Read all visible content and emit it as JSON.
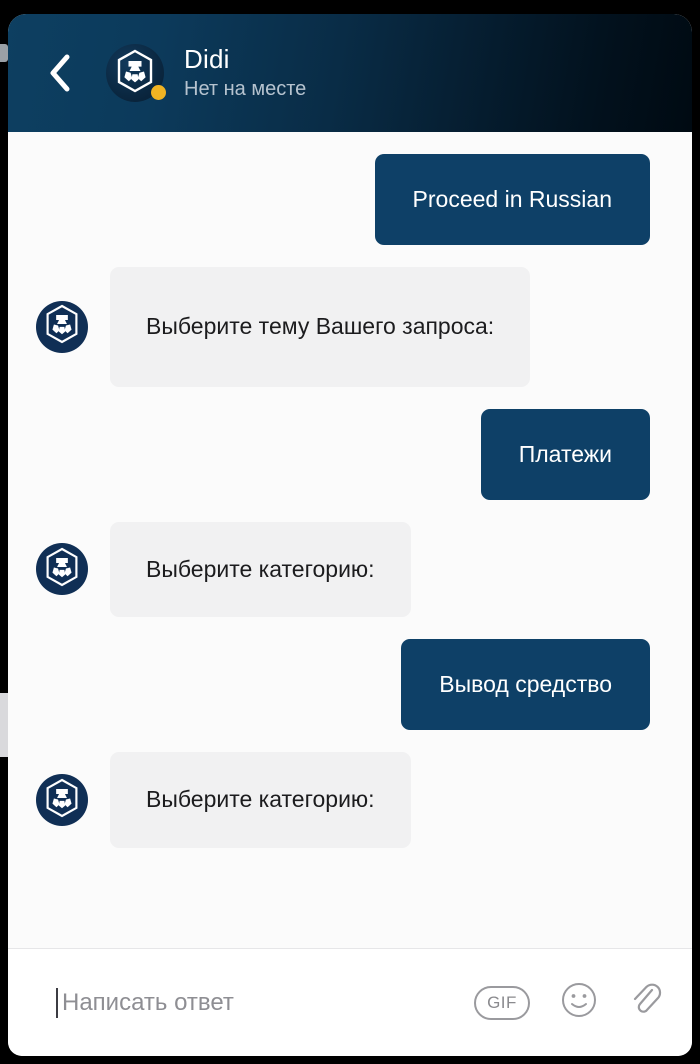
{
  "header": {
    "back_icon": "chevron-left-icon",
    "avatar_icon": "crypto-com-logo-icon",
    "title": "Didi",
    "status": "Нет на месте",
    "status_dot_color": "#f0b323",
    "gradient_start": "#0d3f61",
    "gradient_end": "#000a12"
  },
  "theme": {
    "outgoing_bubble": "#0e4067",
    "incoming_bubble": "#f1f1f2",
    "outgoing_text": "#ffffff",
    "incoming_text": "#1c1c1e",
    "chat_background": "#fbfbfb"
  },
  "messages": [
    {
      "id": "msg-1",
      "direction": "out",
      "text": "Proceed in Russian"
    },
    {
      "id": "msg-2",
      "direction": "in",
      "text": "Выберите тему Вашего запроса:",
      "avatar_icon": "crypto-com-logo-icon"
    },
    {
      "id": "msg-3",
      "direction": "out",
      "text": "Платежи"
    },
    {
      "id": "msg-4",
      "direction": "in",
      "text": "Выберите категорию:",
      "avatar_icon": "crypto-com-logo-icon"
    },
    {
      "id": "msg-5",
      "direction": "out",
      "text": "Вывод средство"
    },
    {
      "id": "msg-6",
      "direction": "in",
      "text": "Выберите категорию:",
      "avatar_icon": "crypto-com-logo-icon"
    }
  ],
  "composer": {
    "placeholder": "Написать ответ",
    "value": "",
    "gif_label": "GIF",
    "emoji_icon": "smiley-face-icon",
    "attach_icon": "paperclip-icon"
  }
}
